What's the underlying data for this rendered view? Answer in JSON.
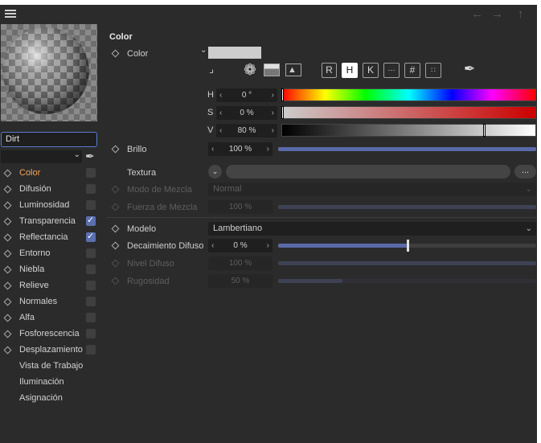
{
  "section_title": "Color",
  "color_label": "Color",
  "swatch_color": "#cdcdcd",
  "mode_buttons": [
    "R",
    "H",
    "K",
    "#"
  ],
  "hsv": [
    {
      "label": "H",
      "value": "0 °"
    },
    {
      "label": "S",
      "value": "0 %"
    },
    {
      "label": "V",
      "value": "80 %"
    }
  ],
  "brillo": {
    "label": "Brillo",
    "value": "100 %",
    "level": 1.0
  },
  "textura": {
    "label": "Textura",
    "more": "..."
  },
  "modo_mezcla": {
    "label": "Modo de Mezcla",
    "value": "Normal"
  },
  "fuerza_mezcla": {
    "label": "Fuerza de Mezcla",
    "value": "100 %",
    "level": 1.0
  },
  "modelo": {
    "label": "Modelo",
    "value": "Lambertiano"
  },
  "decaimiento": {
    "label": "Decaimiento Difuso",
    "value": "0 %",
    "level": 0.5
  },
  "nivel_difuso": {
    "label": "Nivel Difuso",
    "value": "100 %",
    "level": 1.0
  },
  "rugosidad": {
    "label": "Rugosidad",
    "value": "50 %",
    "level": 0.25
  },
  "material_name": "Dirt",
  "channels": [
    {
      "label": "Color",
      "diamond": true,
      "checkbox": true,
      "checked": false,
      "active": true
    },
    {
      "label": "Difusión",
      "diamond": true,
      "checkbox": true,
      "checked": false
    },
    {
      "label": "Luminosidad",
      "diamond": true,
      "checkbox": true,
      "checked": false
    },
    {
      "label": "Transparencia",
      "diamond": true,
      "checkbox": true,
      "checked": true
    },
    {
      "label": "Reflectancia",
      "diamond": true,
      "checkbox": true,
      "checked": true
    },
    {
      "label": "Entorno",
      "diamond": true,
      "checkbox": true,
      "checked": false
    },
    {
      "label": "Niebla",
      "diamond": true,
      "checkbox": true,
      "checked": false
    },
    {
      "label": "Relieve",
      "diamond": true,
      "checkbox": true,
      "checked": false
    },
    {
      "label": "Normales",
      "diamond": true,
      "checkbox": true,
      "checked": false
    },
    {
      "label": "Alfa",
      "diamond": true,
      "checkbox": true,
      "checked": false
    },
    {
      "label": "Fosforescencia",
      "diamond": true,
      "checkbox": true,
      "checked": false
    },
    {
      "label": "Desplazamiento",
      "diamond": true,
      "checkbox": true,
      "checked": false
    },
    {
      "label": "Vista de Trabajo",
      "diamond": false,
      "checkbox": false
    },
    {
      "label": "Iluminación",
      "diamond": false,
      "checkbox": false
    },
    {
      "label": "Asignación",
      "diamond": false,
      "checkbox": false
    }
  ],
  "accent_color": "#5a6aa8",
  "active_channel_color": "#f2a55a"
}
